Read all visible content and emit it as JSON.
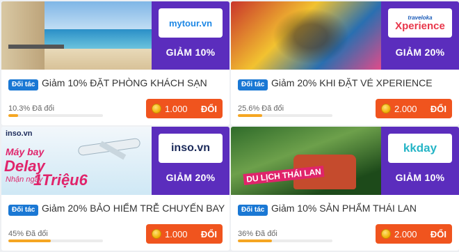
{
  "cards": [
    {
      "partner_logo": "mytour.vn",
      "discount": "GIẢM 10%",
      "tag": "Đối tác",
      "title": "Giảm 10% ĐẶT PHÒNG KHÁCH SẠN",
      "progress_text": "10.3% Đã đổi",
      "progress_pct": 10.3,
      "price": "1.000",
      "button": "ĐỔI",
      "logo_color": "#1e88e5"
    },
    {
      "partner_logo": "Xperience",
      "partner_logo_small": "traveloka",
      "discount": "GIẢM 20%",
      "tag": "Đối tác",
      "title": "Giảm 20% KHI ĐẶT VÉ XPERIENCE",
      "progress_text": "25.6% Đã đổi",
      "progress_pct": 25.6,
      "price": "2.000",
      "button": "ĐỔI",
      "logo_color": "#e8374b"
    },
    {
      "partner_logo": "inso.vn",
      "discount": "GIẢM 20%",
      "tag": "Đối tác",
      "title": "Giảm 20% BẢO HIỂM TRỄ CHUYẾN BAY",
      "progress_text": "45% Đã đổi",
      "progress_pct": 45,
      "price": "1.000",
      "button": "ĐỔI",
      "logo_color": "#1b2a5a",
      "banner_brand": "inso.vn",
      "banner_line1": "Máy bay",
      "banner_line2": "Delay",
      "banner_line3": "Nhận ngay",
      "banner_line4": "1Triệu6"
    },
    {
      "partner_logo": "kkday",
      "discount": "GIẢM 10%",
      "tag": "Đối tác",
      "title": "Giảm 10% SẢN PHẨM THÁI LAN",
      "progress_text": "36% Đã đổi",
      "progress_pct": 36,
      "price": "2.000",
      "button": "ĐỔI",
      "logo_color": "#26b5c6",
      "banner_text": "DU LỊCH THÁI LAN"
    }
  ],
  "colors": {
    "banner_purple": "#5b2dbd",
    "tag_blue": "#1a78d4",
    "button_orange": "#f0541e",
    "progress_orange": "#f5a623"
  }
}
